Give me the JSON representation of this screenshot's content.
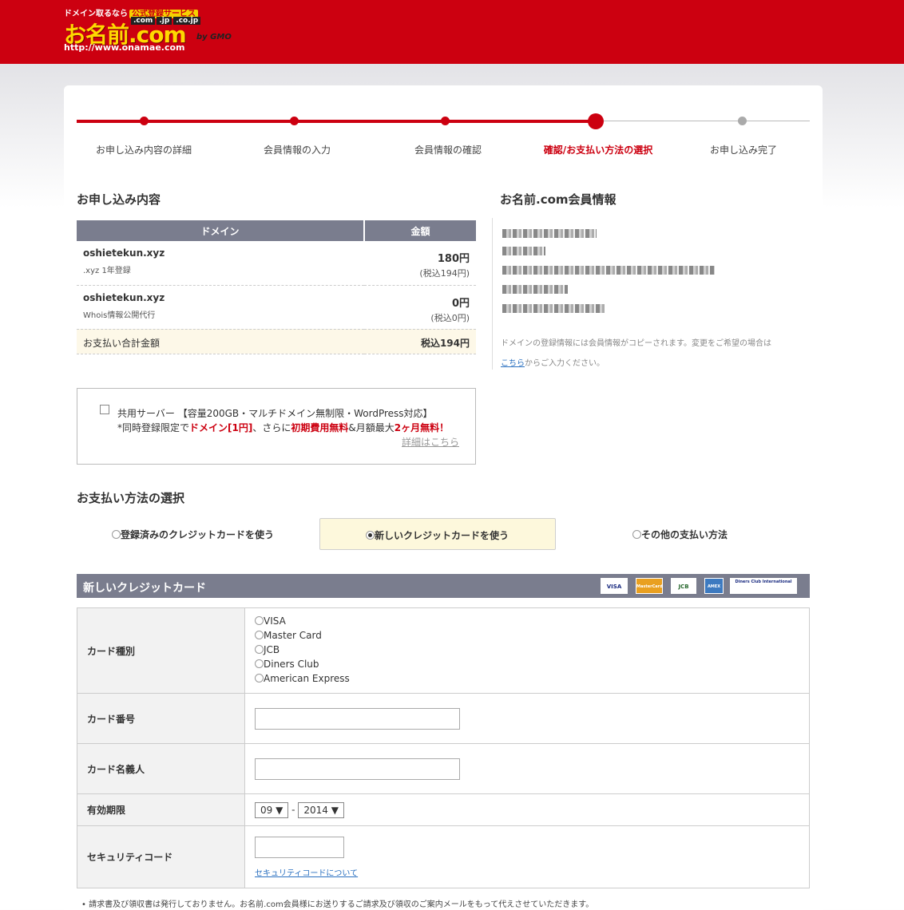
{
  "header": {
    "tagline": "ドメイン取るなら",
    "badge": "公式登録サービス",
    "tlds": [
      ".com",
      ".jp",
      ".co.jp"
    ],
    "logo": "お名前.com",
    "url": "http://www.onamae.com",
    "gmo": "by GMO"
  },
  "steps": [
    {
      "label": "お申し込み内容の詳細",
      "state": "done"
    },
    {
      "label": "会員情報の入力",
      "state": "done"
    },
    {
      "label": "会員情報の確認",
      "state": "done"
    },
    {
      "label": "確認/お支払い方法の選択",
      "state": "current"
    },
    {
      "label": "お申し込み完了",
      "state": "todo"
    }
  ],
  "order": {
    "title": "お申し込み内容",
    "col_domain": "ドメイン",
    "col_price": "金額",
    "rows": [
      {
        "domain": "oshietekun.xyz",
        "detail": ".xyz 1年登録",
        "price": "180円",
        "tax": "(税込194円)"
      },
      {
        "domain": "oshietekun.xyz",
        "detail": "Whois情報公開代行",
        "price": "0円",
        "tax": "(税込0円)"
      }
    ],
    "total_label": "お支払い合計金額",
    "total_value": "税込194円"
  },
  "member": {
    "title": "お名前.com会員情報",
    "note_1": "ドメインの登録情報には会員情報がコピーされます。変更をご希望の場合は",
    "note_link": "こちら",
    "note_2": "からご入力ください。"
  },
  "server": {
    "line1": "共用サーバー 【容量200GB・マルチドメイン無制限・WordPress対応】",
    "line2_a": "*同時登録限定で",
    "line2_b": "ドメイン[1円]",
    "line2_c": "、さらに",
    "line2_d": "初期費用無料",
    "line2_e": "&月額最大",
    "line2_f": "2ヶ月無料！",
    "more": "詳細はこちら"
  },
  "payment": {
    "title": "お支払い方法の選択",
    "options": [
      {
        "label": "登録済みのクレジットカードを使う",
        "selected": false
      },
      {
        "label": "新しいクレジットカードを使う",
        "selected": true
      },
      {
        "label": "その他の支払い方法",
        "selected": false
      }
    ]
  },
  "card": {
    "title": "新しいクレジットカード",
    "logos": [
      "VISA",
      "MasterCard",
      "JCB",
      "AMEX",
      "Diners Club International"
    ],
    "type_label": "カード種別",
    "types": [
      "VISA",
      "Master Card",
      "JCB",
      "Diners Club",
      "American Express"
    ],
    "number_label": "カード番号",
    "holder_label": "カード名義人",
    "expiry_label": "有効期限",
    "expiry_month": "09",
    "expiry_sep": "-",
    "expiry_year": "2014",
    "security_label": "セキュリティコード",
    "security_link": "セキュリティコードについて"
  },
  "footnote": "請求書及び領収書は発行しておりません。お名前.com会員様にお送りするご請求及び領収のご案内メールをもって代えさせていただきます。",
  "colors": {
    "brand_red": "#cc0010",
    "header_gray": "#7a7d8e",
    "highlight": "#fdf8dc"
  }
}
